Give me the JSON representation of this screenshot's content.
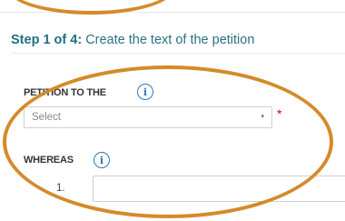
{
  "step": {
    "number_label": "Step 1 of 4:",
    "title": "Create the text of the petition"
  },
  "form": {
    "petition_to": {
      "label": "PETITION TO THE",
      "info_glyph": "i",
      "select_value": "Select",
      "caret": "▾",
      "required_mark": "*"
    },
    "whereas": {
      "label": "WHEREAS",
      "info_glyph": "i",
      "items": [
        {
          "number": "1.",
          "value": ""
        }
      ]
    }
  },
  "colors": {
    "accent_teal": "#2d7186",
    "info_blue": "#2f78b7",
    "required_red": "#d0021b",
    "annotation_orange": "#d58a2a"
  },
  "icons": [
    "info-icon",
    "chevron-down-icon"
  ]
}
